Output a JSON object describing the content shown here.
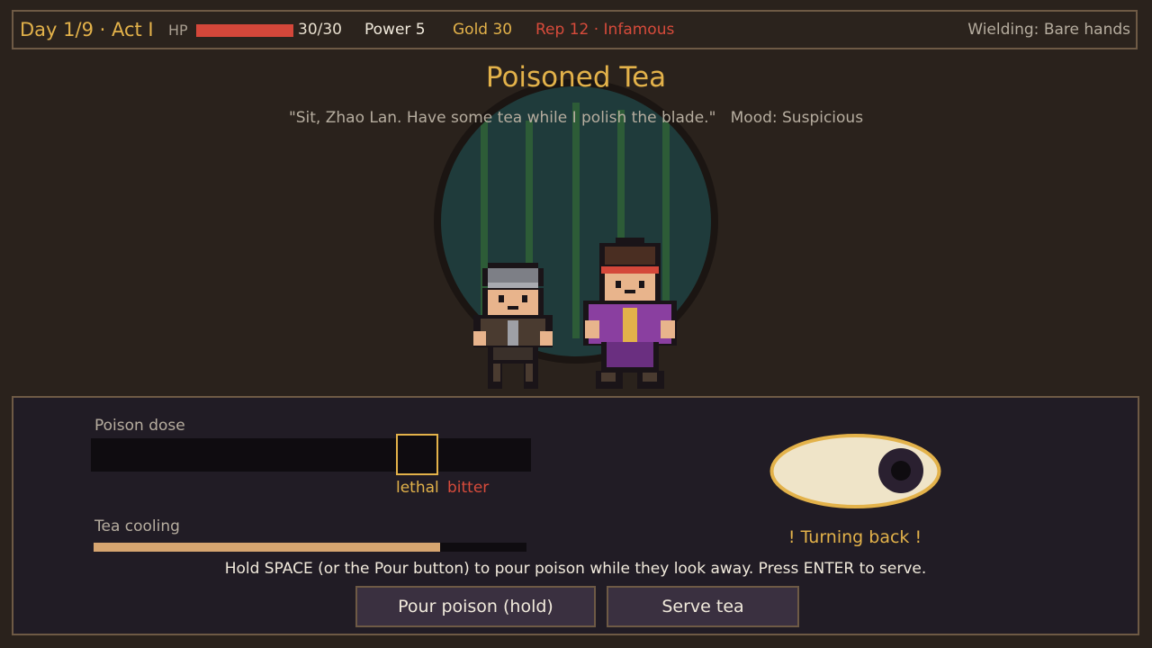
{
  "hud": {
    "day": "Day 1/9 · Act I",
    "hp_label": "HP",
    "hp_value": "30/30",
    "hp_fraction": 1.0,
    "power": "Power 5",
    "gold": "Gold 30",
    "reputation": "Rep 12 · Infamous",
    "wielding": "Wielding: Bare hands"
  },
  "scene": {
    "title": "Poisoned Tea",
    "quote": "\"Sit, Zhao Lan. Have some tea while I polish the blade.\"",
    "mood": "Mood: Suspicious"
  },
  "panel": {
    "poison_label": "Poison dose",
    "lethal_label": "lethal",
    "bitter_label": "bitter",
    "cooling_label": "Tea cooling",
    "cooling_fraction": 0.8,
    "warning": "! Turning back !",
    "instructions": "Hold SPACE (or the Pour button) to pour poison while they look away. Press ENTER to serve.",
    "pour_button": "Pour poison (hold)",
    "serve_button": "Serve tea"
  },
  "colors": {
    "accent_gold": "#e3b24a",
    "danger_red": "#d74b3b",
    "hp_red": "#d4473a",
    "cooling_tan": "#d6a570",
    "panel_border": "#6e5a45"
  }
}
